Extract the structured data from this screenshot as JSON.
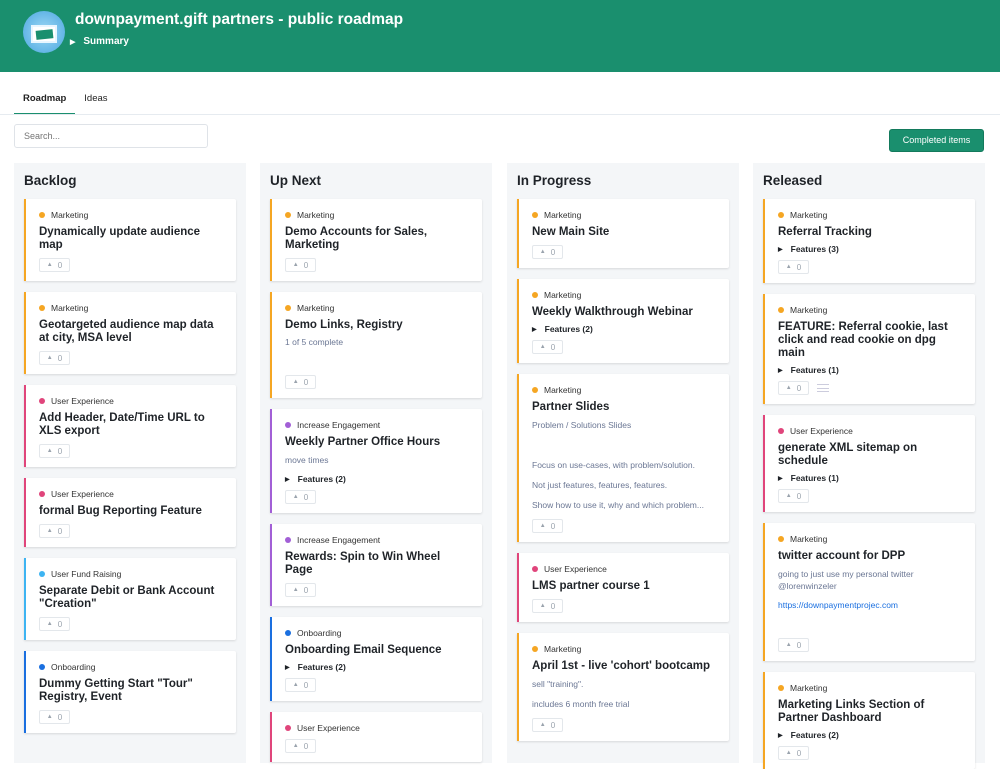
{
  "header": {
    "title": "downpayment.gift partners - public roadmap",
    "summary": "Summary"
  },
  "tabs": [
    {
      "label": "Roadmap",
      "active": true
    },
    {
      "label": "Ideas",
      "active": false
    }
  ],
  "search": {
    "placeholder": "Search..."
  },
  "completed_button": "Completed items",
  "colors": {
    "Marketing": "#f5a623",
    "User Experience": "#e0457b",
    "User Fund Raising": "#3db4f2",
    "Onboarding": "#1a6fe0",
    "Increase Engagement": "#a25fd6"
  },
  "columns": [
    {
      "title": "Backlog",
      "cards": [
        {
          "tag": "Marketing",
          "title": "Dynamically update audience map",
          "votes": "0"
        },
        {
          "tag": "Marketing",
          "title": "Geotargeted audience map data at city, MSA level",
          "votes": "0"
        },
        {
          "tag": "User Experience",
          "title": "Add Header, Date/Time URL to XLS export",
          "votes": "0"
        },
        {
          "tag": "User Experience",
          "title": "formal Bug Reporting Feature",
          "votes": "0"
        },
        {
          "tag": "User Fund Raising",
          "title": "Separate Debit or Bank Account \"Creation\"",
          "votes": "0"
        },
        {
          "tag": "Onboarding",
          "title": "Dummy Getting Start \"Tour\" Registry, Event",
          "votes": "0"
        }
      ]
    },
    {
      "title": "Up Next",
      "cards": [
        {
          "tag": "Marketing",
          "title": "Demo Accounts for Sales, Marketing",
          "votes": "0"
        },
        {
          "tag": "Marketing",
          "title": "Demo Links, Registry",
          "progress": "1 of 5 complete",
          "votes": "0",
          "spacer": true
        },
        {
          "tag": "Increase Engagement",
          "title": "Weekly Partner Office Hours",
          "desc": [
            "move times"
          ],
          "features": "Features (2)",
          "votes": "0"
        },
        {
          "tag": "Increase Engagement",
          "title": "Rewards: Spin to Win Wheel Page",
          "votes": "0"
        },
        {
          "tag": "Onboarding",
          "title": "Onboarding Email Sequence",
          "features": "Features (2)",
          "votes": "0"
        },
        {
          "tag": "User Experience",
          "title": "",
          "votes": "0"
        }
      ]
    },
    {
      "title": "In Progress",
      "cards": [
        {
          "tag": "Marketing",
          "title": "New Main Site",
          "votes": "0"
        },
        {
          "tag": "Marketing",
          "title": "Weekly Walkthrough Webinar",
          "features": "Features (2)",
          "votes": "0"
        },
        {
          "tag": "Marketing",
          "title": "Partner  Slides",
          "desc": [
            "Problem / Solutions Slides",
            "",
            "Focus on use-cases, with problem/solution.",
            "Not just features, features, features.",
            "Show how to use it, why and which problem..."
          ],
          "votes": "0"
        },
        {
          "tag": "User Experience",
          "title": "LMS partner course 1",
          "votes": "0"
        },
        {
          "tag": "Marketing",
          "title": "April 1st - live 'cohort' bootcamp",
          "desc": [
            "sell \"training\".",
            "  includes 6 month free trial"
          ],
          "votes": "0"
        }
      ]
    },
    {
      "title": "Released",
      "cards": [
        {
          "tag": "Marketing",
          "title": "Referral Tracking",
          "features": "Features (3)",
          "votes": "0"
        },
        {
          "tag": "Marketing",
          "title": "FEATURE: Referral cookie, last click and read cookie on dpg main",
          "features": "Features (1)",
          "votes": "0",
          "list": true
        },
        {
          "tag": "User Experience",
          "title": "generate XML sitemap on schedule",
          "features": "Features (1)",
          "votes": "0"
        },
        {
          "tag": "Marketing",
          "title": "twitter account for DPP",
          "desc": [
            "going to just use my personal twitter @lorenwinzeler"
          ],
          "link": "https://downpaymentprojec.com",
          "votes": "0",
          "spacer": true
        },
        {
          "tag": "Marketing",
          "title": "Marketing Links Section of Partner Dashboard",
          "features": "Features (2)",
          "votes": "0"
        }
      ]
    }
  ]
}
